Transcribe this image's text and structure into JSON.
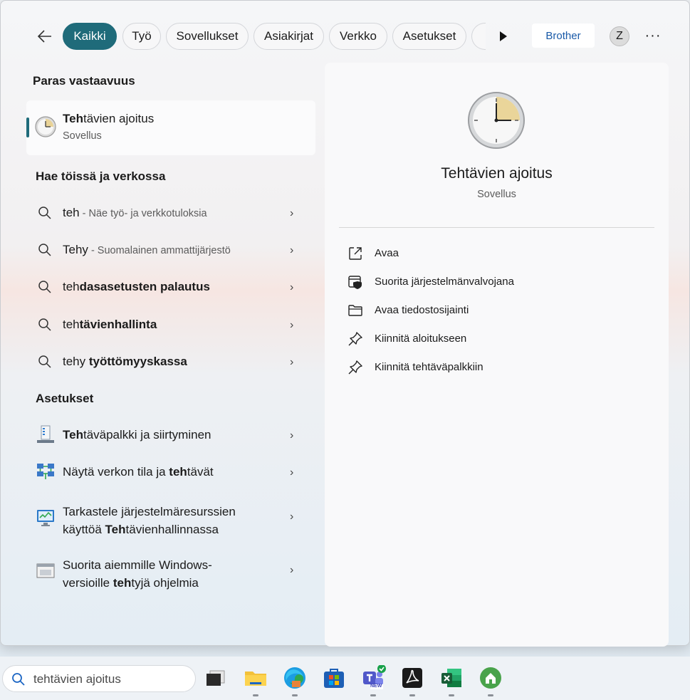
{
  "filters": {
    "tabs": [
      "Kaikki",
      "Työ",
      "Sovellukset",
      "Asiakirjat",
      "Verkko",
      "Asetukset"
    ],
    "active": "Kaikki",
    "brother_label": "Brother",
    "avatar_letter": "Z",
    "more_label": "···"
  },
  "best_match": {
    "section": "Paras vastaavuus",
    "title_bold": "Teh",
    "title_rest": "tävien ajoitus",
    "subtitle": "Sovellus"
  },
  "web": {
    "section": "Hae töissä ja verkossa",
    "items": [
      {
        "prefix": "teh",
        "bold": "",
        "hint": " - Näe työ- ja verkkotuloksia"
      },
      {
        "prefix": "Tehy",
        "bold": "",
        "hint": " - Suomalainen ammattijärjestö"
      },
      {
        "prefix": "teh",
        "bold": "dasasetusten palautus",
        "hint": ""
      },
      {
        "prefix": "teh",
        "bold": "tävienhallinta",
        "hint": ""
      },
      {
        "prefix": "tehy ",
        "bold": "työttömyyskassa",
        "hint": ""
      }
    ]
  },
  "settings": {
    "section": "Asetukset",
    "item1": {
      "bold": "Teh",
      "rest": "täväpalkki ja siirtyminen"
    },
    "item2": {
      "pre": "Näytä verkon tila ja ",
      "bold": "teh",
      "rest": "tävät"
    },
    "item3": {
      "line1": "Tarkastele järjestelmäresurssien",
      "line2_pre": "käyttöä ",
      "line2_bold": "Teh",
      "line2_rest": "tävienhallinnassa"
    },
    "item4": {
      "line1": "Suorita aiemmille Windows-",
      "line2_pre": "versioille ",
      "line2_bold": "teh",
      "line2_rest": "tyjä ohjelmia"
    }
  },
  "preview": {
    "title": "Tehtävien ajoitus",
    "subtitle": "Sovellus",
    "actions": [
      {
        "label": "Avaa",
        "icon": "open-external-icon"
      },
      {
        "label": "Suorita järjestelmänvalvojana",
        "icon": "run-as-admin-icon"
      },
      {
        "label": "Avaa tiedostosijainti",
        "icon": "folder-icon"
      },
      {
        "label": "Kiinnitä aloitukseen",
        "icon": "pin-icon"
      },
      {
        "label": "Kiinnitä tehtäväpalkkiin",
        "icon": "pin-icon"
      }
    ]
  },
  "taskbar": {
    "search_value": "tehtävien ajoitus",
    "apps": [
      "task-view",
      "file-explorer",
      "edge",
      "microsoft-store",
      "teams-new",
      "acrobat",
      "excel",
      "home"
    ],
    "teams_badge": "NEW"
  },
  "colors": {
    "accent": "#1f6b7a",
    "brother": "#1a5aa8"
  }
}
